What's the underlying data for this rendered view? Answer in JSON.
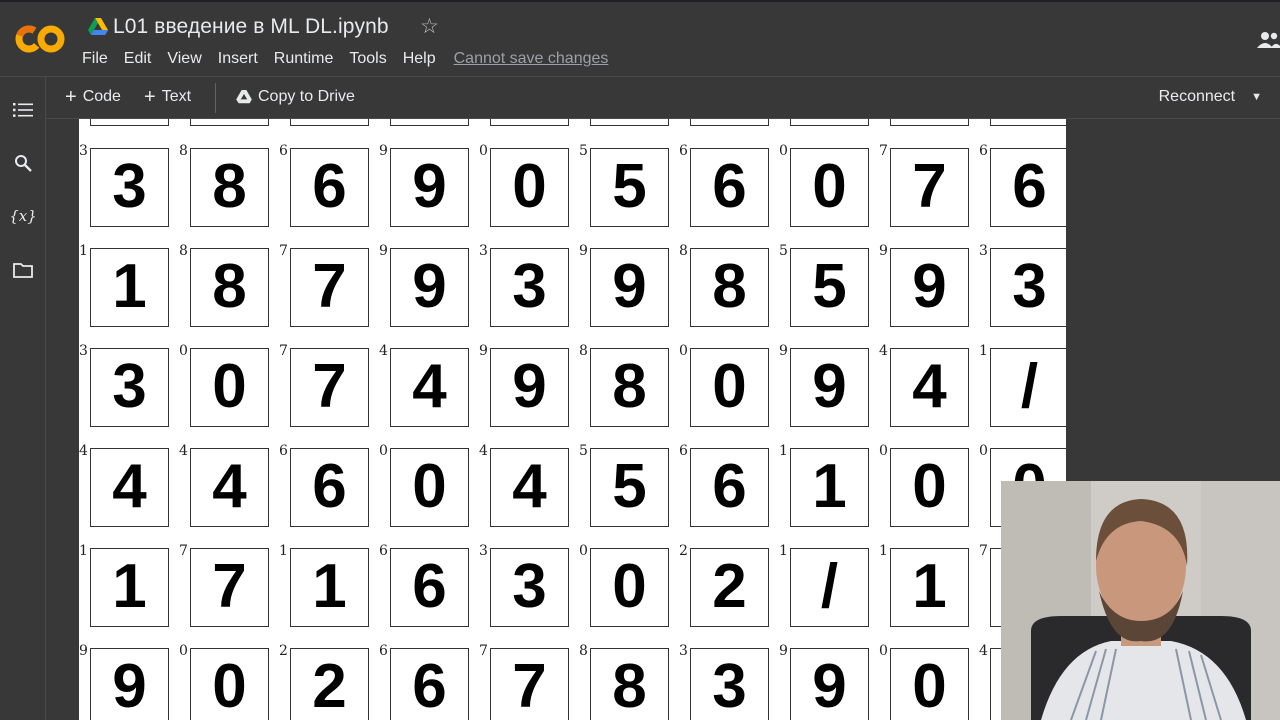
{
  "header": {
    "title": "L01 введение в ML DL.ipynb",
    "menu": [
      "File",
      "Edit",
      "View",
      "Insert",
      "Runtime",
      "Tools",
      "Help"
    ],
    "status_link": "Cannot save changes"
  },
  "toolbar": {
    "code_label": "Code",
    "text_label": "Text",
    "copy_label": "Copy to Drive",
    "connect_label": "Reconnect"
  },
  "colors": {
    "bg": "#383838",
    "logo_orange": "#f9ab00",
    "logo_dark": "#e8710a"
  },
  "icons": [
    "colab-logo-icon",
    "drive-icon",
    "star-icon",
    "people-icon",
    "toc-icon",
    "search-icon",
    "variables-icon",
    "folder-icon",
    "plus-icon",
    "caret-down-icon"
  ],
  "figure": {
    "rows": [
      {
        "cells": [
          {
            "label": "3",
            "digit": "3"
          },
          {
            "label": "8",
            "digit": "8"
          },
          {
            "label": "6",
            "digit": "6"
          },
          {
            "label": "9",
            "digit": "9"
          },
          {
            "label": "0",
            "digit": "0"
          },
          {
            "label": "5",
            "digit": "5"
          },
          {
            "label": "6",
            "digit": "6"
          },
          {
            "label": "0",
            "digit": "0"
          },
          {
            "label": "7",
            "digit": "7"
          },
          {
            "label": "6",
            "digit": "6"
          }
        ]
      },
      {
        "cells": [
          {
            "label": "1",
            "digit": "1"
          },
          {
            "label": "8",
            "digit": "8"
          },
          {
            "label": "7",
            "digit": "7"
          },
          {
            "label": "9",
            "digit": "9"
          },
          {
            "label": "3",
            "digit": "3"
          },
          {
            "label": "9",
            "digit": "9"
          },
          {
            "label": "8",
            "digit": "8"
          },
          {
            "label": "5",
            "digit": "5"
          },
          {
            "label": "9",
            "digit": "9"
          },
          {
            "label": "3",
            "digit": "3"
          }
        ]
      },
      {
        "cells": [
          {
            "label": "3",
            "digit": "3"
          },
          {
            "label": "0",
            "digit": "0"
          },
          {
            "label": "7",
            "digit": "7"
          },
          {
            "label": "4",
            "digit": "4"
          },
          {
            "label": "9",
            "digit": "9"
          },
          {
            "label": "8",
            "digit": "8"
          },
          {
            "label": "0",
            "digit": "0"
          },
          {
            "label": "9",
            "digit": "9"
          },
          {
            "label": "4",
            "digit": "4"
          },
          {
            "label": "1",
            "digit": "/"
          }
        ]
      },
      {
        "cells": [
          {
            "label": "4",
            "digit": "4"
          },
          {
            "label": "4",
            "digit": "4"
          },
          {
            "label": "6",
            "digit": "6"
          },
          {
            "label": "0",
            "digit": "0"
          },
          {
            "label": "4",
            "digit": "4"
          },
          {
            "label": "5",
            "digit": "5"
          },
          {
            "label": "6",
            "digit": "6"
          },
          {
            "label": "1",
            "digit": "1"
          },
          {
            "label": "0",
            "digit": "0"
          },
          {
            "label": "0",
            "digit": "0"
          }
        ]
      },
      {
        "cells": [
          {
            "label": "1",
            "digit": "1"
          },
          {
            "label": "7",
            "digit": "7"
          },
          {
            "label": "1",
            "digit": "1"
          },
          {
            "label": "6",
            "digit": "6"
          },
          {
            "label": "3",
            "digit": "3"
          },
          {
            "label": "0",
            "digit": "0"
          },
          {
            "label": "2",
            "digit": "2"
          },
          {
            "label": "1",
            "digit": "/"
          },
          {
            "label": "1",
            "digit": "1"
          },
          {
            "label": "7",
            "digit": "7"
          }
        ]
      },
      {
        "cells": [
          {
            "label": "9",
            "digit": "9"
          },
          {
            "label": "0",
            "digit": "0"
          },
          {
            "label": "2",
            "digit": "2"
          },
          {
            "label": "6",
            "digit": "6"
          },
          {
            "label": "7",
            "digit": "7"
          },
          {
            "label": "8",
            "digit": "8"
          },
          {
            "label": "3",
            "digit": "3"
          },
          {
            "label": "9",
            "digit": "9"
          },
          {
            "label": "0",
            "digit": "0"
          },
          {
            "label": "4",
            "digit": "4"
          }
        ]
      }
    ]
  }
}
